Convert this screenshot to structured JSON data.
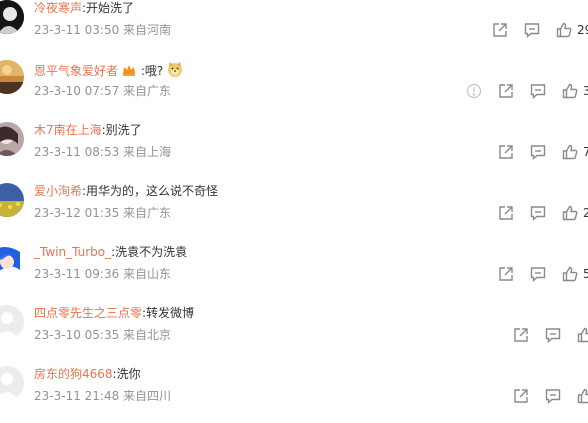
{
  "comments": [
    {
      "user": "冷夜寒声",
      "text": ":开始洗了",
      "meta": "23-3-11 03:50 来自河南",
      "likes": "29"
    },
    {
      "user": "恩平气象爱好者",
      "text": ":哦?",
      "meta": "23-3-10 07:57 来自广东",
      "likes": "3"
    },
    {
      "user": "木7南在上海",
      "text": ":别洗了",
      "meta": "23-3-11 08:53 来自上海",
      "likes": "7"
    },
    {
      "user": "爱小洵希",
      "text": ":用华为的，这么说不奇怪",
      "meta": "23-3-12 01:35 来自广东",
      "likes": "2"
    },
    {
      "user": "_Twin_Turbo_",
      "text": ":洗袁不为洗袁",
      "meta": "23-3-11 09:36 来自山东",
      "likes": "5"
    },
    {
      "user": "四点零先生之三点零",
      "text": ":转发微博",
      "meta": "23-3-10 05:35 来自北京",
      "likes": ""
    },
    {
      "user": "房东的狗4668",
      "text": ":洗你",
      "meta": "23-3-11 21:48 来自四川",
      "likes": ""
    }
  ],
  "colors": {
    "username": "#eb7350",
    "meta": "#939393",
    "text": "#333333",
    "icon": "#8a8a8a"
  },
  "icons": [
    "report-icon",
    "share-icon",
    "comment-icon",
    "like-icon",
    "crown-badge-icon",
    "doge-emoji-icon"
  ]
}
